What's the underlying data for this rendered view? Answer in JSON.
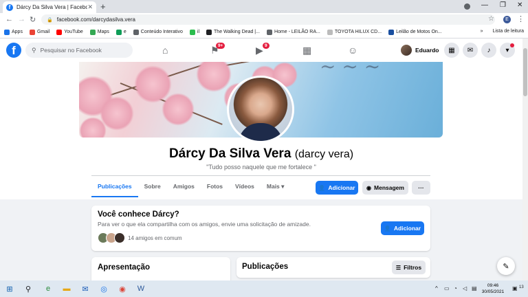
{
  "browser": {
    "tab_title": "Dárcy Da Silva Vera | Facebook",
    "url": "facebook.com/darcydasilva.vera",
    "profile_initial": "E",
    "bookmarks": [
      {
        "label": "Apps",
        "color": "#1a73e8"
      },
      {
        "label": "Gmail",
        "color": "#ea4335"
      },
      {
        "label": "YouTube",
        "color": "#ff0000"
      },
      {
        "label": "Maps",
        "color": "#34a853"
      },
      {
        "label": "e",
        "color": "#0f9d58"
      },
      {
        "label": "Conteúdo Interativo",
        "color": "#5f6368"
      },
      {
        "label": "il",
        "color": "#2bbd4e"
      },
      {
        "label": "The Walking Dead |...",
        "color": "#202124"
      },
      {
        "label": "Home - LEILÃO RA...",
        "color": "#5f6368"
      },
      {
        "label": "TOYOTA HILUX CD...",
        "color": "#bbbbbb"
      },
      {
        "label": "Leilão de Motos On...",
        "color": "#1a4fa0"
      }
    ],
    "reading_list": "Lista de leitura"
  },
  "fb": {
    "search_placeholder": "Pesquisar no Facebook",
    "badge_pages": "9+",
    "badge_watch": "9",
    "user_name": "Eduardo"
  },
  "profile": {
    "name": "Dárcy Da Silva Vera",
    "alt_name": "(darcy vera)",
    "bio": "\"Tudo posso naquele que me fortalece \"",
    "tabs": [
      "Publicações",
      "Sobre",
      "Amigos",
      "Fotos",
      "Vídeos",
      "Mais ▾"
    ],
    "add_label": "Adicionar",
    "message_label": "Mensagem",
    "more_label": "···"
  },
  "know_card": {
    "title": "Você conhece Dárcy?",
    "subtitle": "Para ver o que ela compartilha com os amigos, envie uma solicitação de amizade.",
    "add_label": "Adicionar",
    "mutual": "14 amigos em comum"
  },
  "intro": {
    "title": "Apresentação"
  },
  "posts": {
    "title": "Publicações",
    "filter_label": "Filtros"
  },
  "taskbar": {
    "time": "09:46",
    "date": "30/05/2021",
    "notifications": "13"
  }
}
